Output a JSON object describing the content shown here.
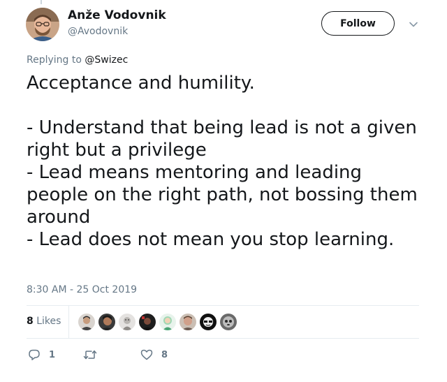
{
  "author": {
    "name": "Anže Vodovnik",
    "handle": "@Avodovnik",
    "avatar_icon": "profile-photo"
  },
  "follow_label": "Follow",
  "reply": {
    "prefix": "Replying to ",
    "mention": "@Swizec"
  },
  "tweet_text": "Acceptance and humility.\n\n- Understand that being lead is not a given right but a privilege\n- Lead means mentoring and leading people on the right path, not bossing them around\n- Lead does not mean you stop learning.",
  "timestamp": "8:30 AM - 25 Oct 2019",
  "likes": {
    "count": "8",
    "label": "Likes",
    "liker_avatars": [
      "liker-avatar-1",
      "liker-avatar-2",
      "liker-avatar-3",
      "liker-avatar-4",
      "liker-avatar-5",
      "liker-avatar-6",
      "liker-avatar-7",
      "liker-avatar-8"
    ]
  },
  "actions": {
    "reply_count": "1",
    "retweet_count": "",
    "like_count": "8"
  },
  "colors": {
    "text": "#14171a",
    "muted": "#657786",
    "divider": "#e6ecf0"
  }
}
